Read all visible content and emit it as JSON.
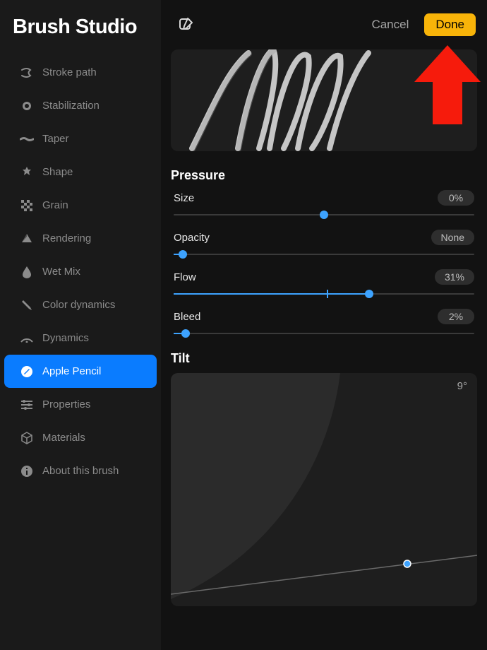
{
  "sidebar": {
    "title": "Brush Studio",
    "items": [
      {
        "label": "Stroke path",
        "icon": "stroke-path-icon",
        "active": false
      },
      {
        "label": "Stabilization",
        "icon": "stabilization-icon",
        "active": false
      },
      {
        "label": "Taper",
        "icon": "taper-icon",
        "active": false
      },
      {
        "label": "Shape",
        "icon": "shape-icon",
        "active": false
      },
      {
        "label": "Grain",
        "icon": "grain-icon",
        "active": false
      },
      {
        "label": "Rendering",
        "icon": "rendering-icon",
        "active": false
      },
      {
        "label": "Wet Mix",
        "icon": "wet-mix-icon",
        "active": false
      },
      {
        "label": "Color dynamics",
        "icon": "color-dynamics-icon",
        "active": false
      },
      {
        "label": "Dynamics",
        "icon": "dynamics-icon",
        "active": false
      },
      {
        "label": "Apple Pencil",
        "icon": "apple-pencil-icon",
        "active": true
      },
      {
        "label": "Properties",
        "icon": "properties-icon",
        "active": false
      },
      {
        "label": "Materials",
        "icon": "materials-icon",
        "active": false
      },
      {
        "label": "About this brush",
        "icon": "about-icon",
        "active": false
      }
    ]
  },
  "topbar": {
    "cancel_label": "Cancel",
    "done_label": "Done"
  },
  "pressure": {
    "title": "Pressure",
    "sliders": [
      {
        "label": "Size",
        "value_text": "0%",
        "thumb_pct": 50,
        "fill_pct": 0,
        "tick_pct": null
      },
      {
        "label": "Opacity",
        "value_text": "None",
        "thumb_pct": 3,
        "fill_pct": 3,
        "tick_pct": null
      },
      {
        "label": "Flow",
        "value_text": "31%",
        "thumb_pct": 65,
        "fill_pct": 65,
        "tick_pct": 51
      },
      {
        "label": "Bleed",
        "value_text": "2%",
        "thumb_pct": 4,
        "fill_pct": 4,
        "tick_pct": null
      }
    ]
  },
  "tilt": {
    "title": "Tilt",
    "value_text": "9°"
  }
}
